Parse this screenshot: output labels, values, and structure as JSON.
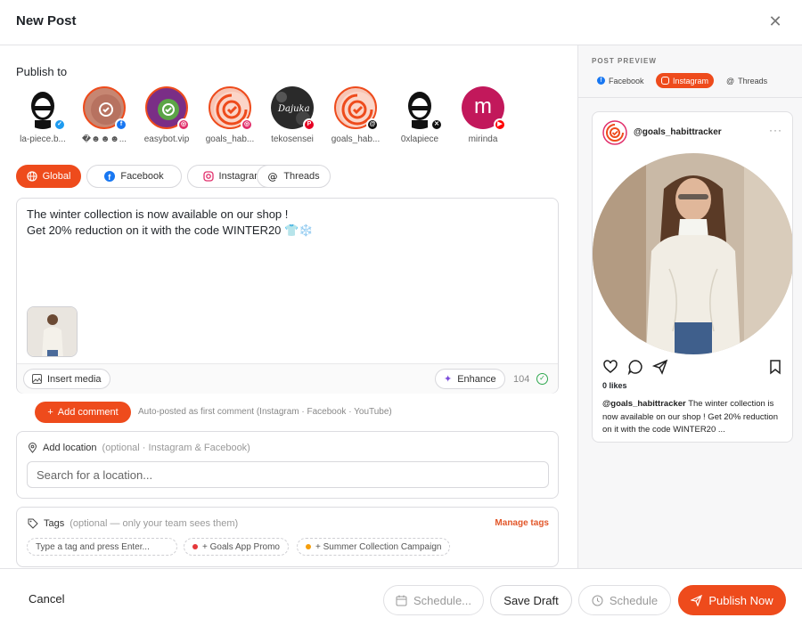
{
  "header": {
    "title": "New Post"
  },
  "publish_to": {
    "label": "Publish to",
    "accounts": [
      {
        "name": "la-piece.b...",
        "network": "bluesky",
        "selected": false
      },
      {
        "name": "�☻☻☻...",
        "network": "facebook",
        "selected": true
      },
      {
        "name": "easybot.vip",
        "network": "instagram",
        "selected": true
      },
      {
        "name": "goals_hab...",
        "network": "instagram",
        "selected": true
      },
      {
        "name": "tekosensei",
        "network": "pinterest",
        "selected": false
      },
      {
        "name": "goals_hab...",
        "network": "threads",
        "selected": true
      },
      {
        "name": "0xlapiece",
        "network": "x",
        "selected": false
      },
      {
        "name": "mirinda",
        "network": "youtube",
        "selected": false,
        "initial": "m"
      }
    ]
  },
  "tabs": [
    "Global",
    "Facebook",
    "Instagram",
    "Threads"
  ],
  "editor": {
    "line1": "The winter collection is now available on our shop !",
    "line2": "Get 20% reduction on it with the code WINTER20 👕❄️",
    "insert_media": "Insert media",
    "enhance": "Enhance",
    "char_count": "104"
  },
  "comment": {
    "button": "Add comment",
    "note": "Auto-posted as first comment (Instagram · Facebook · YouTube)"
  },
  "location": {
    "label": "Add location",
    "optional": "(optional · Instagram & Facebook)",
    "placeholder": "Search for a location..."
  },
  "tags": {
    "label": "Tags",
    "optional": "(optional — only your team sees them)",
    "manage": "Manage tags",
    "input_placeholder": "Type a tag and press Enter...",
    "items": [
      {
        "label": "+ Goals App Promo",
        "color": "#e5383b"
      },
      {
        "label": "+ Summer Collection Campaign",
        "color": "#f59e0b"
      }
    ]
  },
  "preview": {
    "label": "POST PREVIEW",
    "tabs": [
      "Facebook",
      "Instagram",
      "Threads"
    ],
    "handle": "@goals_habittracker",
    "likes": "0 likes",
    "caption_handle": "@goals_habittracker",
    "caption_text": " The winter collection is now available on our shop ! Get 20% reduction on it with the code WINTER20 ..."
  },
  "footer": {
    "cancel": "Cancel",
    "schedule_placeholder": "Schedule...",
    "save_draft": "Save Draft",
    "schedule": "Schedule",
    "publish_now": "Publish Now"
  },
  "colors": {
    "accent": "#ee4b1c",
    "border": "#dcdce0"
  }
}
